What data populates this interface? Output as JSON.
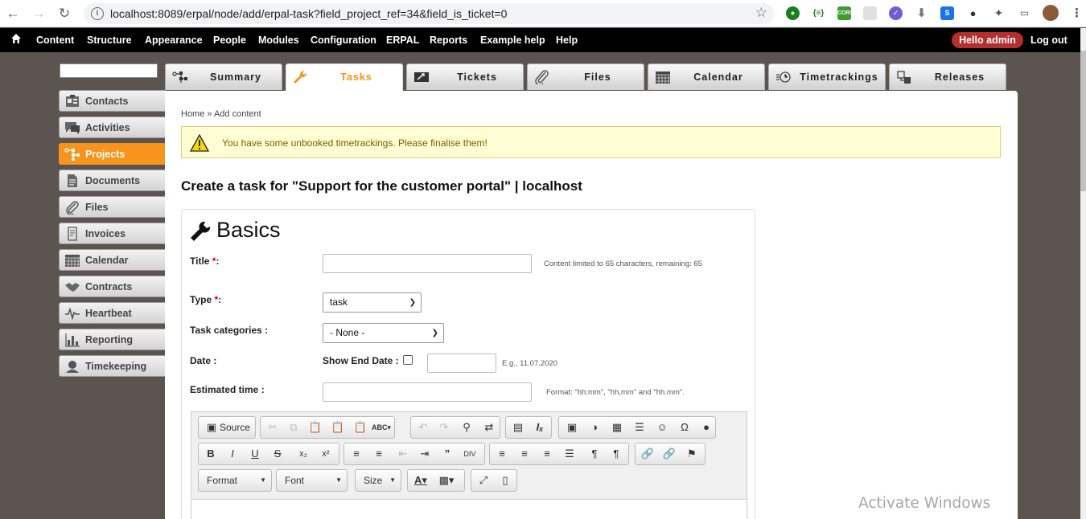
{
  "browser": {
    "url": "localhost:8089/erpal/node/add/erpal-task?field_project_ref=34&field_is_ticket=0"
  },
  "admin_bar": {
    "items": [
      "Content",
      "Structure",
      "Appearance",
      "People",
      "Modules",
      "Configuration",
      "ERPAL",
      "Reports",
      "Example help",
      "Help"
    ],
    "hello_prefix": "Hello",
    "hello_user": "admin",
    "logout": "Log out"
  },
  "sidebar": {
    "items": [
      {
        "label": "Contacts",
        "icon": "contacts-icon"
      },
      {
        "label": "Activities",
        "icon": "activities-icon"
      },
      {
        "label": "Projects",
        "icon": "projects-icon",
        "active": true
      },
      {
        "label": "Documents",
        "icon": "documents-icon"
      },
      {
        "label": "Files",
        "icon": "files-icon"
      },
      {
        "label": "Invoices",
        "icon": "invoices-icon"
      },
      {
        "label": "Calendar",
        "icon": "calendar-icon"
      },
      {
        "label": "Contracts",
        "icon": "contracts-icon"
      },
      {
        "label": "Heartbeat",
        "icon": "heartbeat-icon"
      },
      {
        "label": "Reporting",
        "icon": "reporting-icon"
      },
      {
        "label": "Timekeeping",
        "icon": "timekeeping-icon"
      }
    ]
  },
  "tabs": [
    {
      "label": "Summary",
      "icon": "summary-icon"
    },
    {
      "label": "Tasks",
      "icon": "wrench-icon",
      "active": true
    },
    {
      "label": "Tickets",
      "icon": "tickets-icon"
    },
    {
      "label": "Files",
      "icon": "paperclip-icon"
    },
    {
      "label": "Calendar",
      "icon": "calendar-icon"
    },
    {
      "label": "Timetrackings",
      "icon": "timetracking-icon"
    },
    {
      "label": "Releases",
      "icon": "releases-icon"
    }
  ],
  "breadcrumb": "Home » Add content",
  "warning": {
    "prefix": "You have some unbooked timetrackings.",
    "link": "Please finalise them!"
  },
  "page_title": "Create a task for \"Support for the customer portal\" | localhost",
  "form": {
    "legend": "Basics",
    "title_label": "Title",
    "title_value": "",
    "title_hint": "Content limited to 65 characters, remaining: 65",
    "type_label": "Type",
    "type_value": "task",
    "categories_label": "Task categories :",
    "categories_value": "- None -",
    "date_label": "Date :",
    "show_end_date_label": "Show End Date :",
    "date_value": "",
    "date_hint": "E.g., 11.07.2020",
    "estimated_label": "Estimated time :",
    "estimated_value": "",
    "estimated_hint": "Format: \"hh:mm\", \"hh,mm\" and \"hh.mm\".",
    "required_marker": "*",
    "colon": ":"
  },
  "editor": {
    "source_label": "Source",
    "format_label": "Format",
    "font_label": "Font",
    "size_label": "Size"
  },
  "watermark": "Activate Windows",
  "colors": {
    "accent": "#f7941d",
    "admin_bar": "#000000",
    "hello_badge": "#b52f2f",
    "warning_bg": "#fffdd3"
  }
}
